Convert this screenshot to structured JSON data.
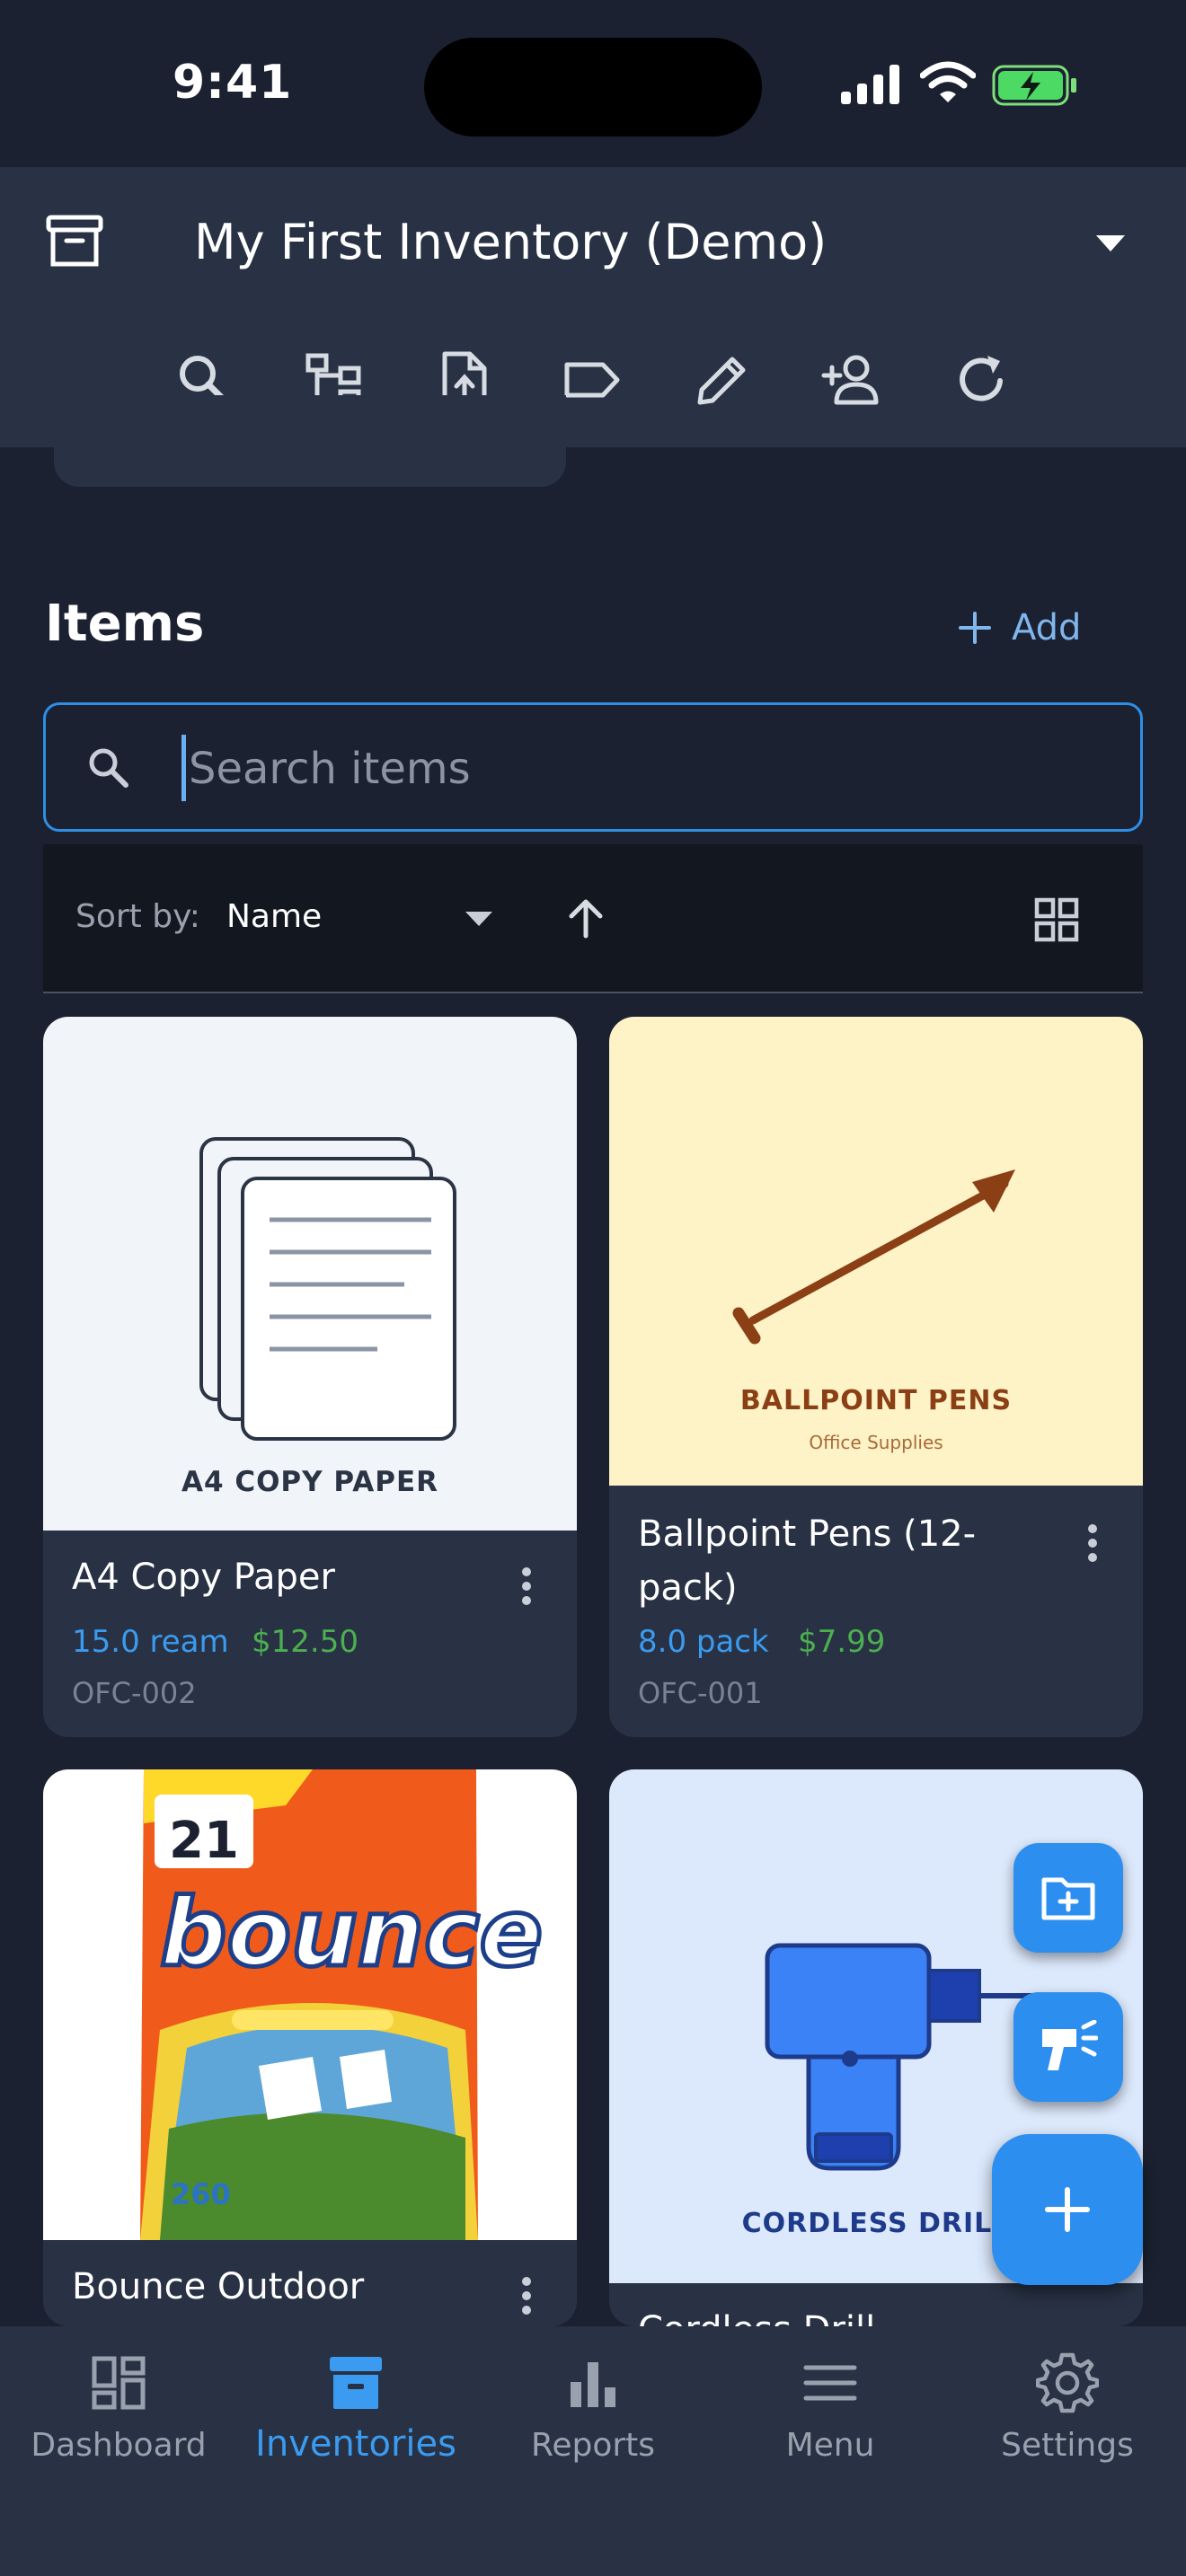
{
  "status_bar": {
    "time": "9:41"
  },
  "header": {
    "inventory_name": "My First Inventory (Demo)",
    "toolbar": [
      {
        "name": "search-icon"
      },
      {
        "name": "hierarchy-icon"
      },
      {
        "name": "file-upload-icon"
      },
      {
        "name": "tag-icon"
      },
      {
        "name": "pencil-icon"
      },
      {
        "name": "add-person-icon"
      },
      {
        "name": "refresh-icon"
      }
    ]
  },
  "items_section": {
    "title": "Items",
    "add_label": "Add",
    "search_placeholder": "Search items",
    "sort_label": "Sort by:",
    "sort_value": "Name",
    "sort_direction": "ascending",
    "view_mode": "grid"
  },
  "items": [
    {
      "name": "A4 Copy Paper",
      "quantity": "15.0 ream",
      "price": "$12.50",
      "sku": "OFC-002",
      "image_caption": "A4 COPY PAPER"
    },
    {
      "name_line1": "Ballpoint Pens (12-",
      "name_line2": "pack)",
      "quantity": "8.0 pack",
      "price": "$7.99",
      "sku": "OFC-001",
      "image_caption": "BALLPOINT PENS",
      "image_subcaption": "Office Supplies"
    },
    {
      "name": "Bounce Outdoor",
      "image_brand": "bounce",
      "image_badge": "21",
      "image_count": "260"
    },
    {
      "name": "Cordless Drill",
      "image_caption": "CORDLESS DRILL"
    }
  ],
  "fabs": [
    {
      "name": "new-folder-icon"
    },
    {
      "name": "barcode-scanner-icon"
    },
    {
      "name": "plus-icon"
    }
  ],
  "bottom_nav": [
    {
      "label": "Dashboard",
      "icon": "dashboard-icon",
      "active": false
    },
    {
      "label": "Inventories",
      "icon": "archive-icon",
      "active": true
    },
    {
      "label": "Reports",
      "icon": "bar-chart-icon",
      "active": false
    },
    {
      "label": "Menu",
      "icon": "menu-icon",
      "active": false
    },
    {
      "label": "Settings",
      "icon": "gear-icon",
      "active": false
    }
  ],
  "colors": {
    "background": "#1b2130",
    "surface": "#283244",
    "accent": "#2c8ff0",
    "price_green": "#4caf50"
  }
}
